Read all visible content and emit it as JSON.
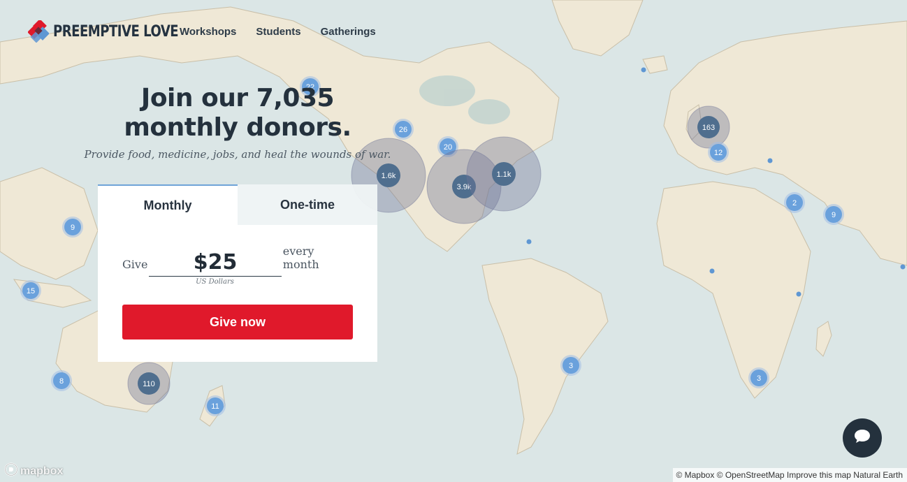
{
  "brand": {
    "name": "PREEMPTIVE LOVE",
    "colors": {
      "red": "#e0192b",
      "blue": "#5f97d3",
      "navy": "#24313d"
    }
  },
  "nav": {
    "items": [
      "Workshops",
      "Students",
      "Gatherings"
    ]
  },
  "hero": {
    "headline_line1": "Join our 7,035",
    "headline_line2": "monthly donors.",
    "subhead": "Provide food, medicine, jobs, and heal the wounds of war."
  },
  "donate": {
    "tabs": [
      "Monthly",
      "One-time"
    ],
    "active_tab": "Monthly",
    "give_label": "Give",
    "amount": "$25",
    "period_label": "every month",
    "currency_note": "US Dollars",
    "button_label": "Give now"
  },
  "map": {
    "clusters": [
      {
        "label": "22",
        "size": "small"
      },
      {
        "label": "26",
        "size": "small"
      },
      {
        "label": "20",
        "size": "small"
      },
      {
        "label": "1.6k",
        "size": "large"
      },
      {
        "label": "3.9k",
        "size": "large"
      },
      {
        "label": "1.1k",
        "size": "large"
      },
      {
        "label": "163",
        "size": "medium"
      },
      {
        "label": "12",
        "size": "small"
      },
      {
        "label": "2",
        "size": "small"
      },
      {
        "label": "9",
        "size": "small"
      },
      {
        "label": "9",
        "size": "small"
      },
      {
        "label": "15",
        "size": "small"
      },
      {
        "label": "8",
        "size": "small"
      },
      {
        "label": "110",
        "size": "medium"
      },
      {
        "label": "11",
        "size": "small"
      },
      {
        "label": "3",
        "size": "small"
      },
      {
        "label": "3",
        "size": "small"
      }
    ]
  },
  "chat": {
    "icon": "chat-bubble-icon"
  },
  "footer": {
    "mapbox_logo": "mapbox",
    "attribution": [
      "© Mapbox",
      "© OpenStreetMap",
      "Improve this map",
      "Natural Earth"
    ]
  }
}
